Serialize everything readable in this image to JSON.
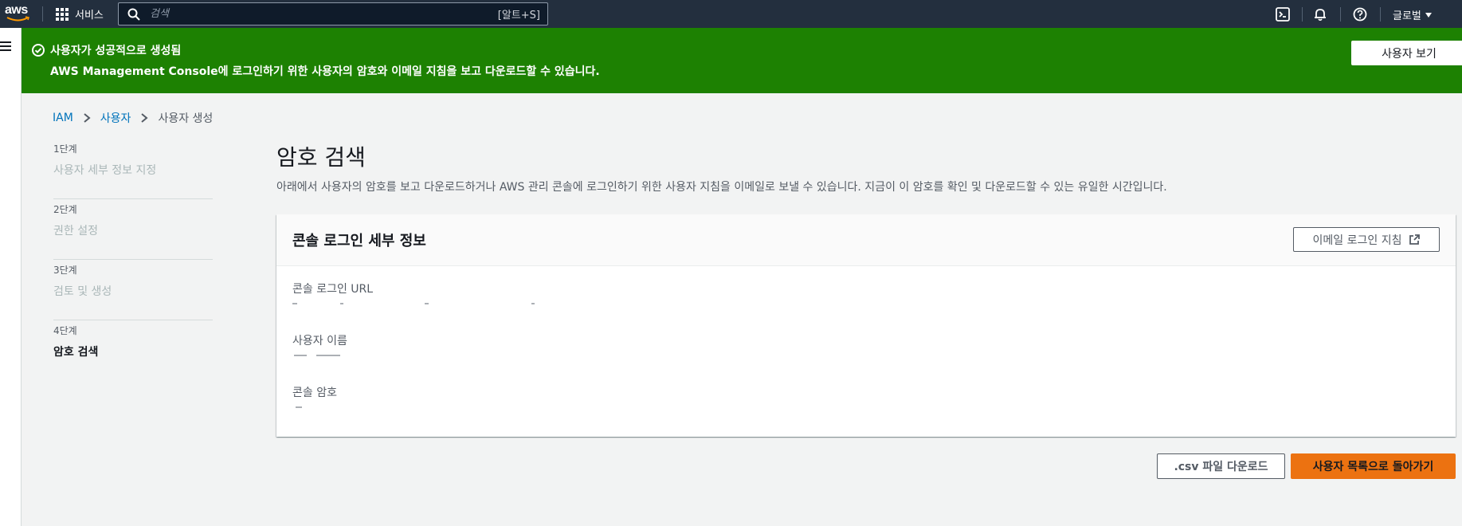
{
  "nav": {
    "logo": "aws",
    "services_label": "서비스",
    "search_placeholder": "검색",
    "search_shortcut": "[알트+S]",
    "region_label": "글로벌",
    "icons": [
      "cloudshell-icon",
      "notifications-icon",
      "help-icon"
    ]
  },
  "flash": {
    "title": "사용자가 성공적으로 생성됨",
    "message": "AWS Management Console에 로그인하기 위한 사용자의 암호와 이메일 지침을 보고 다운로드할 수 있습니다.",
    "button": "사용자 보기",
    "color": "#1d8102"
  },
  "breadcrumb": {
    "items": [
      "IAM",
      "사용자"
    ],
    "current": "사용자 생성"
  },
  "steps": [
    {
      "num": "1단계",
      "name": "사용자 세부 정보 지정"
    },
    {
      "num": "2단계",
      "name": "권한 설정"
    },
    {
      "num": "3단계",
      "name": "검토 및 생성"
    },
    {
      "num": "4단계",
      "name": "암호 검색"
    }
  ],
  "page": {
    "title": "암호 검색",
    "description": "아래에서 사용자의 암호를 보고 다운로드하거나 AWS 관리 콘솔에 로그인하기 위한 사용자 지침을 이메일로 보낼 수 있습니다. 지금이 이 암호를 확인 및 다운로드할 수 있는 유일한 시간입니다."
  },
  "panel": {
    "title": "콘솔 로그인 세부 정보",
    "email_button": "이메일 로그인 지침",
    "fields": [
      {
        "label": "콘솔 로그인 URL"
      },
      {
        "label": "사용자 이름"
      },
      {
        "label": "콘솔 암호"
      }
    ]
  },
  "actions": {
    "csv": ".csv 파일 다운로드",
    "back": "사용자 목록으로 돌아가기",
    "primary_color": "#ec7211"
  }
}
